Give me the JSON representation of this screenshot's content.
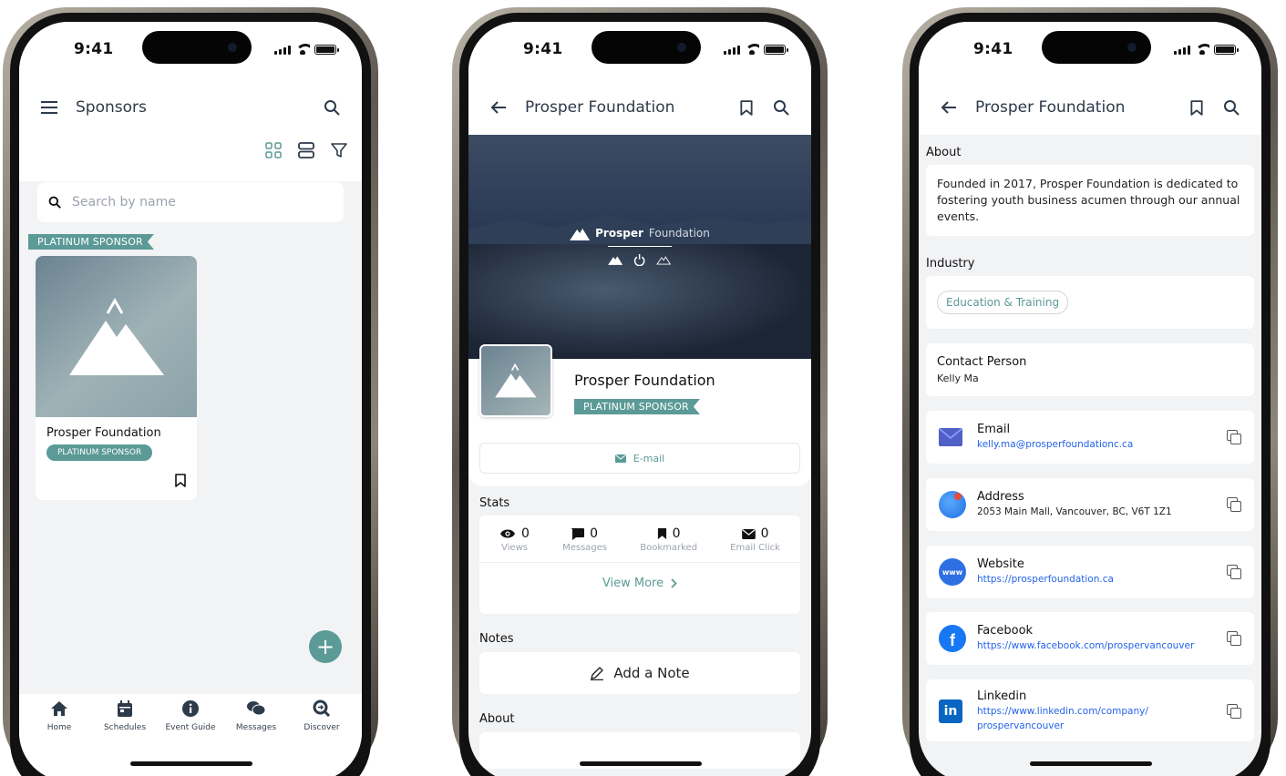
{
  "status": {
    "time": "9:41"
  },
  "phone1": {
    "title": "Sponsors",
    "search_placeholder": "Search by name",
    "tier_ribbon": "PLATINUM SPONSOR",
    "card": {
      "name": "Prosper Foundation",
      "badge": "PLATINUM SPONSOR"
    },
    "fab": "+",
    "tabs": [
      {
        "label": "Home",
        "icon": "home-icon"
      },
      {
        "label": "Schedules",
        "icon": "calendar-icon"
      },
      {
        "label": "Event Guide",
        "icon": "info-icon"
      },
      {
        "label": "Messages",
        "icon": "chat-icon"
      },
      {
        "label": "Discover",
        "icon": "discover-icon"
      }
    ]
  },
  "phone2": {
    "title": "Prosper Foundation",
    "hero_brand_bold": "Prosper",
    "hero_brand_light": "Foundation",
    "name": "Prosper Foundation",
    "badge": "PLATINUM SPONSOR",
    "email_label": "E-mail",
    "stats_label": "Stats",
    "stats": [
      {
        "value": "0",
        "label": "Views",
        "icon": "eye-icon"
      },
      {
        "value": "0",
        "label": "Messages",
        "icon": "message-icon"
      },
      {
        "value": "0",
        "label": "Bookmarked",
        "icon": "bookmark-icon"
      },
      {
        "value": "0",
        "label": "Email Click",
        "icon": "envelope-icon"
      }
    ],
    "view_more": "View More",
    "notes_label": "Notes",
    "add_note": "Add a Note",
    "about_label": "About"
  },
  "phone3": {
    "title": "Prosper Foundation",
    "about_label": "About",
    "about_text": "Founded in 2017, Prosper Foundation is dedicated to fostering youth business acumen through our annual events.",
    "industry_label": "Industry",
    "industry_chip": "Education & Training",
    "contact_person_label": "Contact Person",
    "contact_person": "Kelly Ma",
    "contacts": [
      {
        "title": "Email",
        "value": "kelly.ma@prosperfoundationc.ca",
        "icon": "mail-icon"
      },
      {
        "title": "Address",
        "value": "2053 Main Mall, Vancouver, BC, V6T 1Z1",
        "icon": "map-pin-icon"
      },
      {
        "title": "Website",
        "value": "https://prosperfoundation.ca",
        "icon": "www-icon"
      },
      {
        "title": "Facebook",
        "value": "https://www.facebook.com/prospervancouver",
        "icon": "facebook-icon"
      },
      {
        "title": "Linkedin",
        "value": "https://www.linkedin.com/company/",
        "value2": "prospervancouver",
        "icon": "linkedin-icon"
      }
    ]
  },
  "colors": {
    "accent": "#5b9a96",
    "link": "#2563eb",
    "background": "#f2f3f5"
  }
}
